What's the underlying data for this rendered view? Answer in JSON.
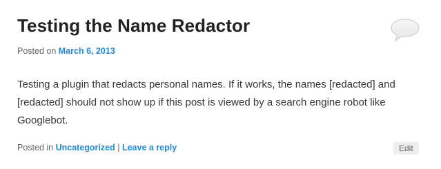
{
  "post": {
    "title": "Testing the Name Redactor",
    "meta": {
      "posted_on_label": "Posted on",
      "date": "March 6, 2013"
    },
    "content": "Testing a plugin that redacts personal names. If it works, the names [redacted] and [redacted] should not show up if this post is viewed by a search engine robot like Googlebot.",
    "footer": {
      "posted_in_label": "Posted in",
      "category": "Uncategorized",
      "separator": "|",
      "reply_link": "Leave a reply",
      "edit_label": "Edit"
    },
    "comment_bubble_icon": "speech-bubble-icon"
  }
}
